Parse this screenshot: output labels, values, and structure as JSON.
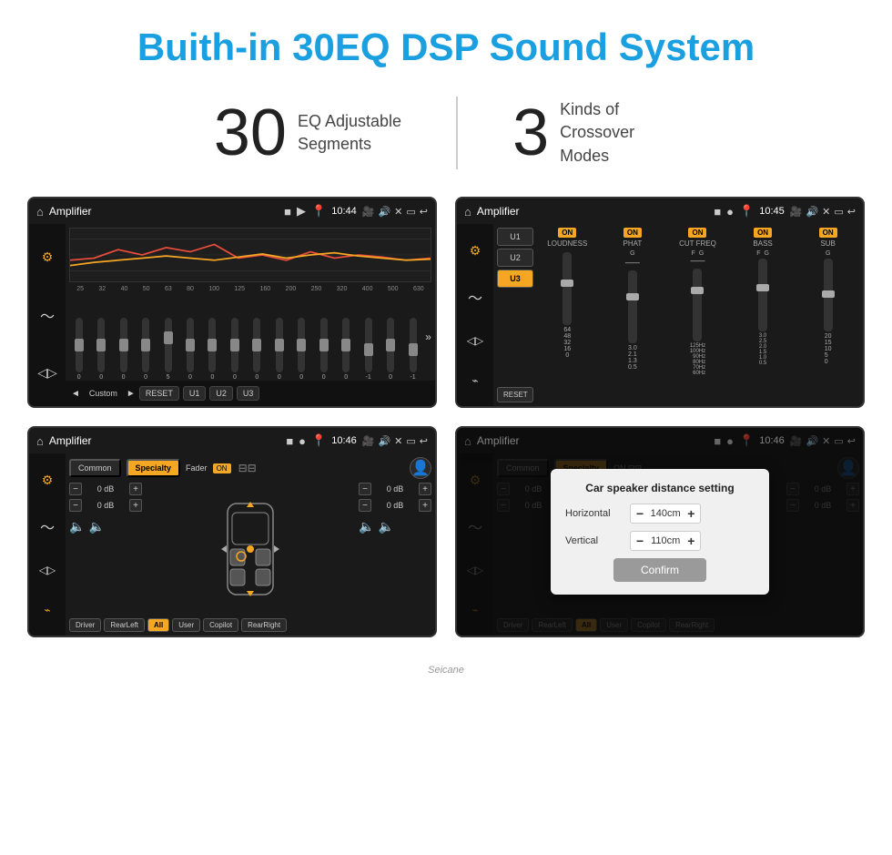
{
  "header": {
    "title": "Buith-in 30EQ DSP Sound System"
  },
  "stats": [
    {
      "number": "30",
      "label": "EQ Adjustable\nSegments"
    },
    {
      "number": "3",
      "label": "Kinds of\nCrossover Modes"
    }
  ],
  "screens": [
    {
      "id": "eq1",
      "status_bar": {
        "home_icon": "⌂",
        "title": "Amplifier",
        "icons": "■ ▶",
        "location": "📍",
        "time": "10:44",
        "camera": "📷",
        "volume": "🔊",
        "close": "✕",
        "rect": "▭",
        "back": "↩"
      },
      "freq_labels": [
        "25",
        "32",
        "40",
        "50",
        "63",
        "80",
        "100",
        "125",
        "160",
        "200",
        "250",
        "320",
        "400",
        "500",
        "630"
      ],
      "slider_values": [
        "0",
        "0",
        "0",
        "0",
        "5",
        "0",
        "0",
        "0",
        "0",
        "0",
        "0",
        "0",
        "0",
        "-1",
        "0",
        "-1"
      ],
      "bottom_buttons": [
        "Custom",
        "RESET",
        "U1",
        "U2",
        "U3"
      ]
    },
    {
      "id": "crossover",
      "status_bar": {
        "title": "Amplifier",
        "time": "10:45"
      },
      "units": [
        "U1",
        "U2",
        "U3"
      ],
      "active_unit": "U3",
      "controls": [
        "LOUDNESS",
        "PHAT",
        "CUT FREQ",
        "BASS",
        "SUB"
      ],
      "reset_label": "RESET"
    },
    {
      "id": "specialty",
      "status_bar": {
        "title": "Amplifier",
        "time": "10:46"
      },
      "tabs": [
        "Common",
        "Specialty"
      ],
      "active_tab": "Specialty",
      "fader_label": "Fader",
      "fader_on": "ON",
      "dB_values": [
        "0 dB",
        "0 dB",
        "0 dB",
        "0 dB"
      ],
      "nav_buttons": [
        "Driver",
        "RearLeft",
        "All",
        "User",
        "Copilot",
        "RearRight"
      ],
      "active_nav": "All"
    },
    {
      "id": "dialog",
      "status_bar": {
        "title": "Amplifier",
        "time": "10:46"
      },
      "dialog": {
        "title": "Car speaker distance setting",
        "horizontal_label": "Horizontal",
        "horizontal_value": "140cm",
        "vertical_label": "Vertical",
        "vertical_value": "110cm",
        "confirm_label": "Confirm"
      }
    }
  ],
  "watermark": "Seicane"
}
